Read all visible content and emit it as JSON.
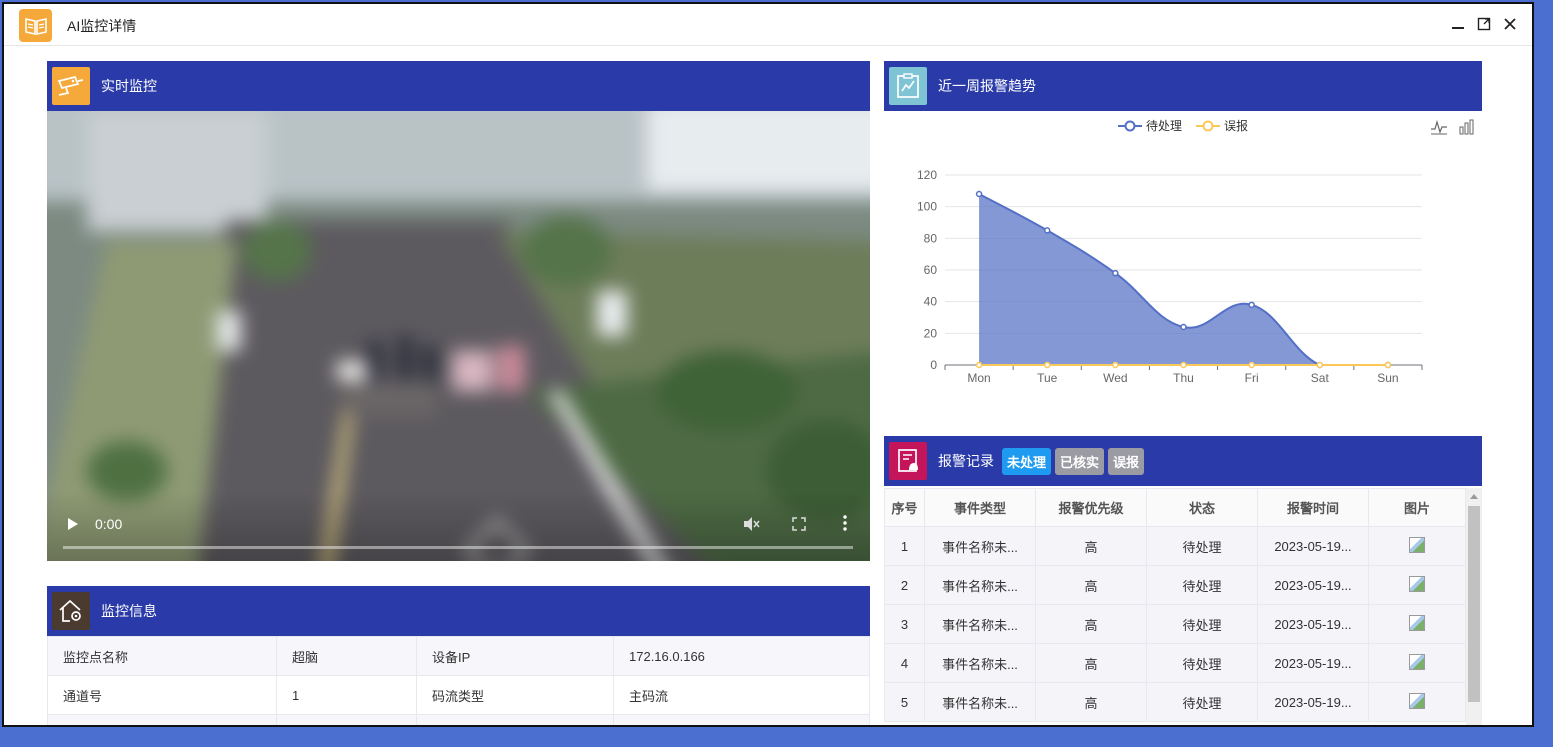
{
  "window": {
    "title": "AI监控详情"
  },
  "live": {
    "title": "实时监控",
    "time": "0:00"
  },
  "info": {
    "title": "监控信息",
    "rows": [
      [
        "监控点名称",
        "超脑",
        "设备IP",
        "172.16.0.166"
      ],
      [
        "通道号",
        "1",
        "码流类型",
        "主码流"
      ]
    ]
  },
  "trend": {
    "title": "近一周报警趋势"
  },
  "chart_data": {
    "type": "area",
    "categories": [
      "Mon",
      "Tue",
      "Wed",
      "Thu",
      "Fri",
      "Sat",
      "Sun"
    ],
    "series": [
      {
        "name": "待处理",
        "values": [
          108,
          85,
          58,
          24,
          38,
          0,
          0
        ],
        "color": "#5470c6"
      },
      {
        "name": "误报",
        "values": [
          0,
          0,
          0,
          0,
          0,
          0,
          0
        ],
        "color": "#fac858"
      }
    ],
    "ylim": [
      0,
      120
    ],
    "yticks": [
      0,
      20,
      40,
      60,
      80,
      100,
      120
    ],
    "grid": true,
    "legend": "top-center"
  },
  "alarm": {
    "title": "报警记录",
    "tabs": [
      "未处理",
      "已核实",
      "误报"
    ],
    "headers": [
      "序号",
      "事件类型",
      "报警优先级",
      "状态",
      "报警时间",
      "图片"
    ],
    "rows": [
      [
        "1",
        "事件名称未...",
        "高",
        "待处理",
        "2023-05-19..."
      ],
      [
        "2",
        "事件名称未...",
        "高",
        "待处理",
        "2023-05-19..."
      ],
      [
        "3",
        "事件名称未...",
        "高",
        "待处理",
        "2023-05-19..."
      ],
      [
        "4",
        "事件名称未...",
        "高",
        "待处理",
        "2023-05-19..."
      ],
      [
        "5",
        "事件名称未...",
        "高",
        "待处理",
        "2023-05-19..."
      ]
    ]
  },
  "colors": {
    "header": "#2a3aa8",
    "accent": "#1e9bf0"
  }
}
